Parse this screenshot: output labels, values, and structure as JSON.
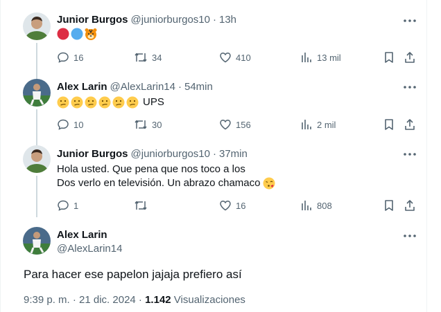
{
  "colors": {
    "text": "#0f1419",
    "secondary": "#536471",
    "line": "#cfd9de",
    "divider": "#eff3f4"
  },
  "tweets": [
    {
      "name": "Junior Burgos",
      "handle": "@juniorburgos10",
      "dot": "·",
      "time": "13h",
      "emoji": [
        "red-circle",
        "blue-circle",
        "tiger-face"
      ],
      "replies": "16",
      "retweets": "34",
      "likes": "410",
      "views": "13 mil"
    },
    {
      "name": "Alex Larin",
      "handle": "@AlexLarin14",
      "dot": "·",
      "time": "54min",
      "emoji": [
        "confused-face",
        "confused-face",
        "confused-face",
        "confused-face",
        "confused-face",
        "confused-face"
      ],
      "text_after": "UPS",
      "replies": "10",
      "retweets": "30",
      "likes": "156",
      "views": "2 mil"
    },
    {
      "name": "Junior Burgos",
      "handle": "@juniorburgos10",
      "dot": "·",
      "time": "37min",
      "text_line1": "Hola usted. Que pena que nos toco a los",
      "text_line2": "Dos verlo en televisión. Un abrazo chamaco",
      "emoji": [
        "face-blowing-kiss"
      ],
      "replies": "1",
      "retweets": "",
      "likes": "16",
      "views": "808"
    }
  ],
  "main": {
    "name": "Alex Larin",
    "handle": "@AlexLarin14",
    "text": "Para hacer ese papelon jajaja prefiero así",
    "time": "9:39 p. m. · 21 dic. 2024 · ",
    "views_count": "1.142",
    "views_label": " Visualizaciones"
  }
}
